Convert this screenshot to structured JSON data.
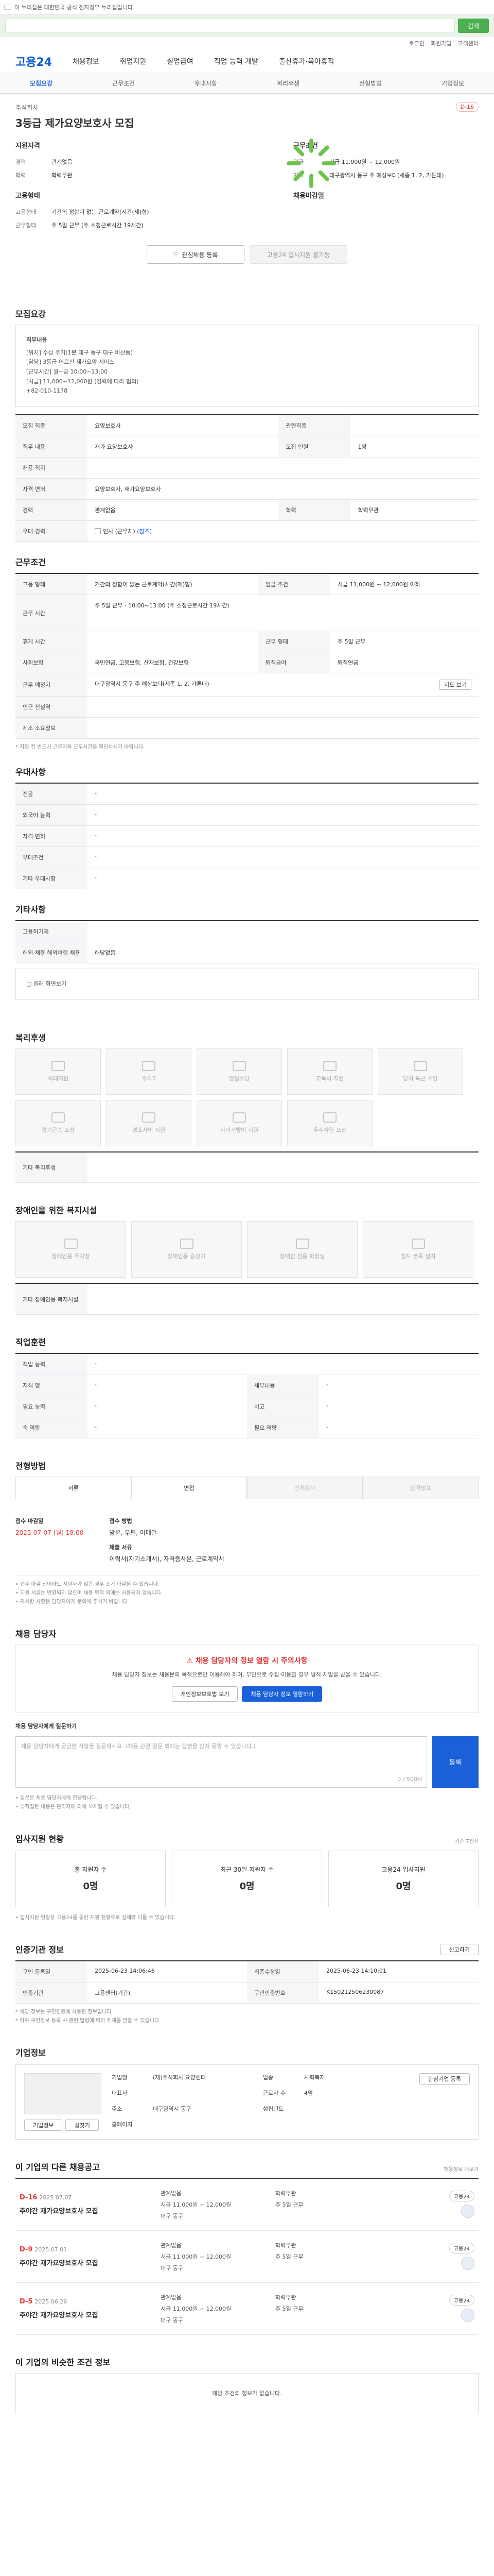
{
  "top": {
    "notice": "이 누리집은 대한민국 공식 전자정부 누리집입니다.",
    "search_placeholder": "",
    "search_btn": "검색",
    "util": [
      "로그인",
      "회원가입",
      "고객센터"
    ]
  },
  "gnb": {
    "logo": "고용24",
    "menus": [
      "채용정보",
      "취업지원",
      "실업급여",
      "직업 능력 개발",
      "출산휴가·육아휴직"
    ]
  },
  "subtabs": [
    "모집요강",
    "근무조건",
    "우대사항",
    "복리후생",
    "전형방법",
    "기업정보"
  ],
  "head": {
    "company": "주식회사",
    "title": "3등급 제가요양보호사 모집",
    "dday": "D-16",
    "logo_label": "주식회사 로고",
    "left_title": "지원자격",
    "left": [
      {
        "k": "경력",
        "v": "관계없음"
      },
      {
        "k": "학력",
        "v": "학력무관"
      }
    ],
    "left2_title": "고용형태",
    "left2": [
      {
        "k": "고용형태",
        "v": "기간의 정함이 없는 근로계약(시간(제)형)"
      },
      {
        "k": "근무형태",
        "v": "주 5일 근무 (주 소정근로시간 19시간)"
      }
    ],
    "right_title": "근무조건",
    "right": [
      {
        "k": "임금",
        "v": "시급 11,000원 ~ 12,000원"
      },
      {
        "k": "지역",
        "v": "대구광역시 동구 주 예상보다(세종 1, 2, 가톤대)"
      }
    ],
    "right2_title": "채용마감일",
    "btn_interest": "관심채용 등록",
    "btn_apply": "고용24 입사지원 불가능"
  },
  "recruit": {
    "heading": "모집요강",
    "box_title": "직무내용",
    "box_lines": [
      "[위치] 수성 주거(1분 대구 동구 대구 비산동)",
      "[담당] 3등급 어르신 재가요양 서비스",
      "[근무시간] 월~금 10:00~13:00",
      "[시급] 11,000~12,000원 (경력에 따라 협의)",
      "+82-010-1178"
    ],
    "rows": [
      {
        "k": "모집 직종",
        "v": "요양보호사",
        "k2": "관련직종",
        "v2": ""
      },
      {
        "k": "직무 내용",
        "v": "재가 요양보호사",
        "k2": "모집 인원",
        "v2": "1명"
      },
      {
        "k": "채용 직위",
        "v": "",
        "k2": "",
        "v2": ""
      },
      {
        "k": "자격 면허",
        "v": "요양보호사, 재가요양보호사",
        "k2": "",
        "v2": ""
      },
      {
        "k": "경력",
        "v": "관계없음",
        "k2": "학력",
        "v2": "학력무관"
      },
      {
        "k": "우대 경력",
        "v": "",
        "k2": "",
        "v2": ""
      }
    ],
    "pay_row_label": "인사 (근무처)",
    "pay_row_value": "(참조)"
  },
  "work": {
    "heading": "근무조건",
    "rows": [
      {
        "k": "고용 형태",
        "v": "기간의 정함이 없는 근로계약(시간(제)형)",
        "k2": "임금 조건",
        "v2": "시급 11,000원 ~ 12,000원 이하"
      },
      {
        "k": "근무 시간",
        "v": "주 5일 근무 · 10:00~13:00 (주 소정근로시간 19시간)",
        "k2": "",
        "v2": ""
      },
      {
        "k": "휴게 시간",
        "v": "",
        "k2": "근무 형태",
        "v2": "주 5일 근무"
      },
      {
        "k": "사회보험",
        "v": "국민연금, 고용보험, 산재보험, 건강보험",
        "k2": "퇴직급여",
        "v2": "퇴직연금"
      },
      {
        "k": "근무 예정지",
        "v": "대구광역시 동구 주 예상보다(세종 1, 2, 가톤대)",
        "k2": "",
        "v2": ""
      },
      {
        "k": "인근 전철역",
        "v": "",
        "k2": "",
        "v2": ""
      },
      {
        "k": "제소 소요정보",
        "v": "",
        "k2": "",
        "v2": ""
      }
    ],
    "map_btn": "지도 보기",
    "note": "* 지원 전 반드시 근무지와 근무시간을 확인하시기 바랍니다."
  },
  "pref": {
    "heading": "우대사항",
    "rows": [
      {
        "k": "전공",
        "v": "-"
      },
      {
        "k": "외국어 능력",
        "v": "-"
      },
      {
        "k": "자격 면허",
        "v": "-"
      },
      {
        "k": "우대조건",
        "v": "-"
      },
      {
        "k": "기타 우대사항",
        "v": "-"
      }
    ]
  },
  "etc": {
    "heading": "기타사항",
    "rows": [
      {
        "k": "고용허가제",
        "v": ""
      },
      {
        "k": "해외 채용 해외여행 채용",
        "v": "해당없음"
      }
    ],
    "view_btn": "원래 화면보기"
  },
  "welfare": {
    "heading": "복리후생",
    "items": [
      "식대지원",
      "주4.5",
      "명절수당",
      "교육비 지원",
      "당직 특근 수당",
      "장기근속 포상",
      "경조사비 지원",
      "자기개발비 지원",
      "우수사원 포상"
    ],
    "rows": [
      {
        "k": "기타 복리후생",
        "v": ""
      }
    ]
  },
  "disabled": {
    "heading": "장애인을 위한 복지시설",
    "items": [
      "장애인용 주차장",
      "장애인용 승강기",
      "장애인 전용 화장실",
      "점자 블록 설치"
    ],
    "rows": [
      {
        "k": "기타 장애인용 복지시설",
        "v": ""
      }
    ]
  },
  "lang": {
    "heading": "직업훈련",
    "rows": [
      {
        "k": "직업 능력",
        "v": "-",
        "k2": "",
        "v2": ""
      },
      {
        "k": "지식 명",
        "v": "-",
        "k2": "세부내용",
        "v2": "-"
      },
      {
        "k": "필요 능력",
        "v": "-",
        "k2": "비고",
        "v2": "-"
      },
      {
        "k": "숙 역량",
        "v": "-",
        "k2": "필요 역량",
        "v2": "-"
      }
    ]
  },
  "process": {
    "heading": "전형방법",
    "steps": [
      "서류",
      "면접",
      "신체검사",
      "합격발표"
    ],
    "d1_label": "접수 마감일",
    "d1_value": "2025-07-07 (월) 18:00",
    "d2_label": "접수 방법",
    "d2_value": "방문, 우편, 이메일",
    "d3_label": "제출 서류",
    "d3_value": "이력서(자기소개서), 자격증사본, 근로계약서",
    "notes": [
      "• 접수 마감 전이라도 지원자가 많은 경우 조기 마감될 수 있습니다.",
      "• 지원 서류는 반환되지 않으며 채용 목적 외에는 사용되지 않습니다.",
      "• 자세한 사항은 담당자에게 문의해 주시기 바랍니다."
    ]
  },
  "contact": {
    "heading": "채용 담당자",
    "alert_hd": "채용 담당자의 정보 열람 시 주의사항",
    "alert_p": "채용 담당자 정보는 채용문의 목적으로만 이용해야 하며, 무단으로 수집·이용할 경우 법적 처벌을 받을 수 있습니다.",
    "btn1": "개인정보보호법 보기",
    "btn2": "채용 담당자 정보 열람하기",
    "q_label": "채용 담당자에게 질문하기",
    "q_placeholder": "채용 담당자에게 궁금한 사항을 질문하세요. (채용 관련 질문 외에는 답변을 받지 못할 수 있습니다.)",
    "q_counter": "0 / 500자",
    "q_btn": "등록",
    "q_notes": [
      "• 질문은 채용 담당자에게 전달됩니다.",
      "• 부적절한 내용은 관리자에 의해 삭제될 수 있습니다."
    ]
  },
  "stats": {
    "heading": "입사지원 현황",
    "sub": "기준 7일전",
    "items": [
      {
        "label": "총 지원자 수",
        "n": "0명"
      },
      {
        "label": "최근 30일 지원자 수",
        "n": "0명"
      },
      {
        "label": "고용24 입사지원",
        "n": "0명"
      }
    ],
    "note": "• 입사지원 현황은 고용24를 통한 지원 현황으로 실제와 다를 수 있습니다."
  },
  "regist": {
    "heading": "인증기관 정보",
    "report_btn": "신고하기",
    "rows": [
      {
        "k": "구인 등록일",
        "v": "2025-06-23 14:06:46",
        "k2": "최종수정일",
        "v2": "2025-06-23 14:10:01"
      },
      {
        "k": "인증기관",
        "v": "고용센터(기관)",
        "k2": "구인인증번호",
        "v2": "K150212506230087"
      }
    ],
    "notes": [
      "* 해당 정보는 구인인증에 사용된 정보입니다.",
      "* 허위 구인정보 등록 시 관련 법령에 따라 제재를 받을 수 있습니다."
    ]
  },
  "companyinfo": {
    "heading": "기업정보",
    "logo": "",
    "interest": "관심기업 등록",
    "rows": [
      {
        "k": "기업명",
        "v": "(재)주식회사 요양센터",
        "k2": "업종",
        "v2": "사회복지"
      },
      {
        "k": "대표자",
        "v": "",
        "k2": "근로자 수",
        "v2": "4명"
      },
      {
        "k": "주소",
        "v": "대구광역시 동구",
        "k2": "설립년도",
        "v2": ""
      },
      {
        "k": "홈페이지",
        "v": "",
        "k2": "",
        "v2": ""
      }
    ],
    "btn_a": "기업정보",
    "btn_b": "길찾기"
  },
  "other": {
    "heading": "이 기업의 다른 채용공고",
    "more": "채용정보 더보기",
    "cards": [
      {
        "dd": "D-16",
        "date": "2025.07.07",
        "name": "주야간 재가요양보호사 모집",
        "pay": "시급 11,000원 ~ 12,000원",
        "edu": "학력무관",
        "career": "관계없음",
        "region": "대구 동구",
        "chip": "고용24",
        "type": "주 5일 근무"
      },
      {
        "dd": "D-9",
        "date": "2025.07.01",
        "name": "주야간 재가요양보호사 모집",
        "pay": "시급 11,000원 ~ 12,000원",
        "edu": "학력무관",
        "career": "관계없음",
        "region": "대구 동구",
        "chip": "고용24",
        "type": "주 5일 근무"
      },
      {
        "dd": "D-5",
        "date": "2025.06.26",
        "name": "주야간 재가요양보호사 모집",
        "pay": "시급 11,000원 ~ 12,000원",
        "edu": "학력무관",
        "career": "관계없음",
        "region": "대구 동구",
        "chip": "고용24",
        "type": "주 5일 근무"
      }
    ]
  },
  "similar": {
    "heading": "이 기업의 비슷한 조건 정보",
    "empty": "해당 조건의 정보가 없습니다."
  },
  "colors": {
    "brand": "#0b5bd3",
    "accent": "#1a60d8",
    "alert": "#e23b3b",
    "green": "#4caf50"
  }
}
